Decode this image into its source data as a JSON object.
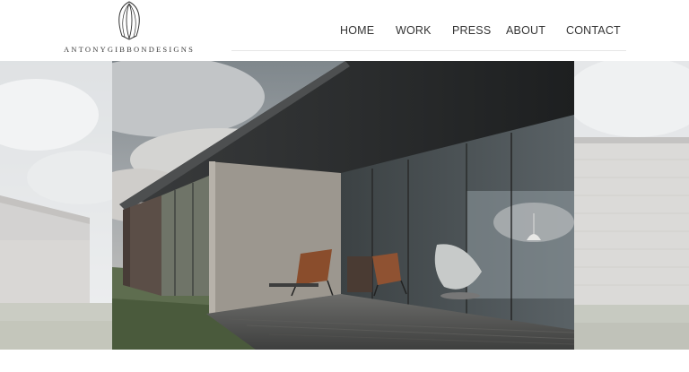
{
  "brand": {
    "logo_text": "ANTONYGIBBONDESIGNS",
    "logo_icon": "leaf-mark-icon"
  },
  "nav": {
    "items": [
      {
        "label": "HOME"
      },
      {
        "label": "WORK"
      },
      {
        "label": "PRESS"
      },
      {
        "label": "ABOUT"
      },
      {
        "label": "CONTACT"
      }
    ]
  },
  "hero": {
    "main_image": "modern-glass-pavilion-photo",
    "left_image": "faded-building-photo",
    "right_image": "faded-house-photo"
  },
  "colors": {
    "nav_text": "#333333",
    "divider": "#e6e6e6",
    "background": "#ffffff"
  }
}
